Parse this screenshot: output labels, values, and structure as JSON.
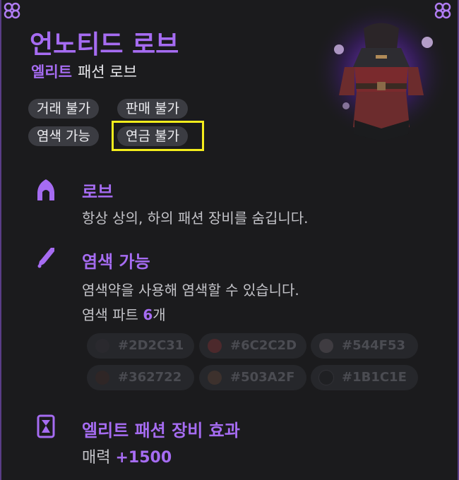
{
  "item": {
    "name": "언노티드 로브",
    "grade": "엘리트",
    "category": "패션 로브"
  },
  "tags": [
    "거래 불가",
    "판매 불가",
    "염색 가능",
    "연금 불가"
  ],
  "sections": {
    "robe": {
      "icon": "hood-icon",
      "title": "로브",
      "description": "항상 상의, 하의 패션 장비를 숨깁니다."
    },
    "dye": {
      "icon": "dye-brush-icon",
      "title": "염색 가능",
      "description": "염색약을 사용해 염색할 수 있습니다.",
      "parts_label": "염색 파트",
      "parts_count": "6",
      "parts_unit": "개",
      "colors": [
        {
          "code": "#2D2C31",
          "swatch": "#2D2C31"
        },
        {
          "code": "#6C2C2D",
          "swatch": "#6C2C2D"
        },
        {
          "code": "#544F53",
          "swatch": "#544F53"
        },
        {
          "code": "#362722",
          "swatch": "#362722"
        },
        {
          "code": "#503A2F",
          "swatch": "#503A2F"
        },
        {
          "code": "#1B1C1E",
          "swatch": "#1B1C1E"
        }
      ]
    },
    "effect": {
      "icon": "elite-fashion-icon",
      "title": "엘리트 패션 장비 효과",
      "stat_label": "매력",
      "stat_value": "+1500"
    }
  },
  "colors": {
    "accent": "#A66CF2",
    "highlight_box": "#F4EC1C",
    "background": "#1B1B1D"
  }
}
